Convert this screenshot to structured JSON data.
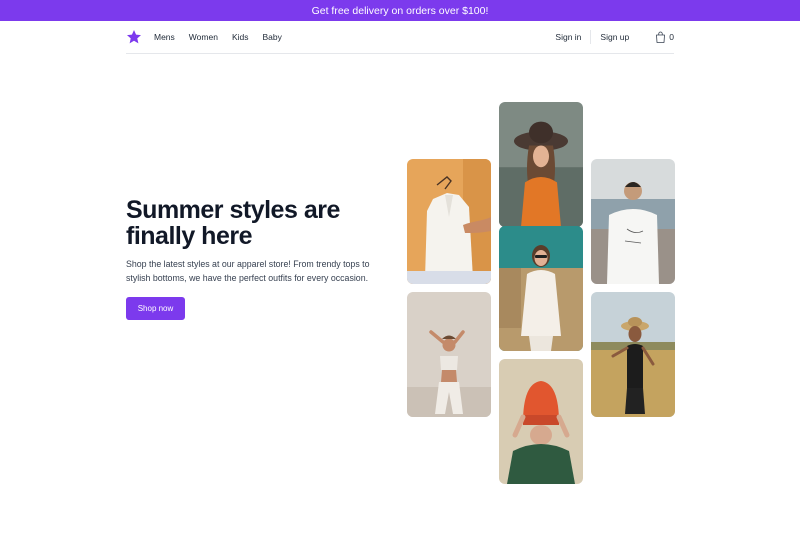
{
  "promo": {
    "text": "Get free delivery on orders over $100!"
  },
  "brand": {
    "logo_icon": "star-icon",
    "accent_color": "#7c3aed"
  },
  "nav": {
    "links": [
      "Mens",
      "Women",
      "Kids",
      "Baby"
    ],
    "sign_in": "Sign in",
    "sign_up": "Sign up",
    "cart_icon": "shopping-bag-icon",
    "cart_count": "0"
  },
  "hero": {
    "title": "Summer styles are finally here",
    "description": "Shop the latest styles at our apparel store! From trendy tops to stylish bottoms, we have the perfect outfits for every occasion.",
    "cta_label": "Shop now"
  },
  "gallery": {
    "images": [
      "white-shirt-on-hanger",
      "woman-in-crop-top",
      "woman-in-wide-brim-hat",
      "woman-in-sunglasses-white-dress",
      "woman-in-red-beanie",
      "man-in-white-tshirt",
      "woman-in-straw-hat-field"
    ]
  }
}
